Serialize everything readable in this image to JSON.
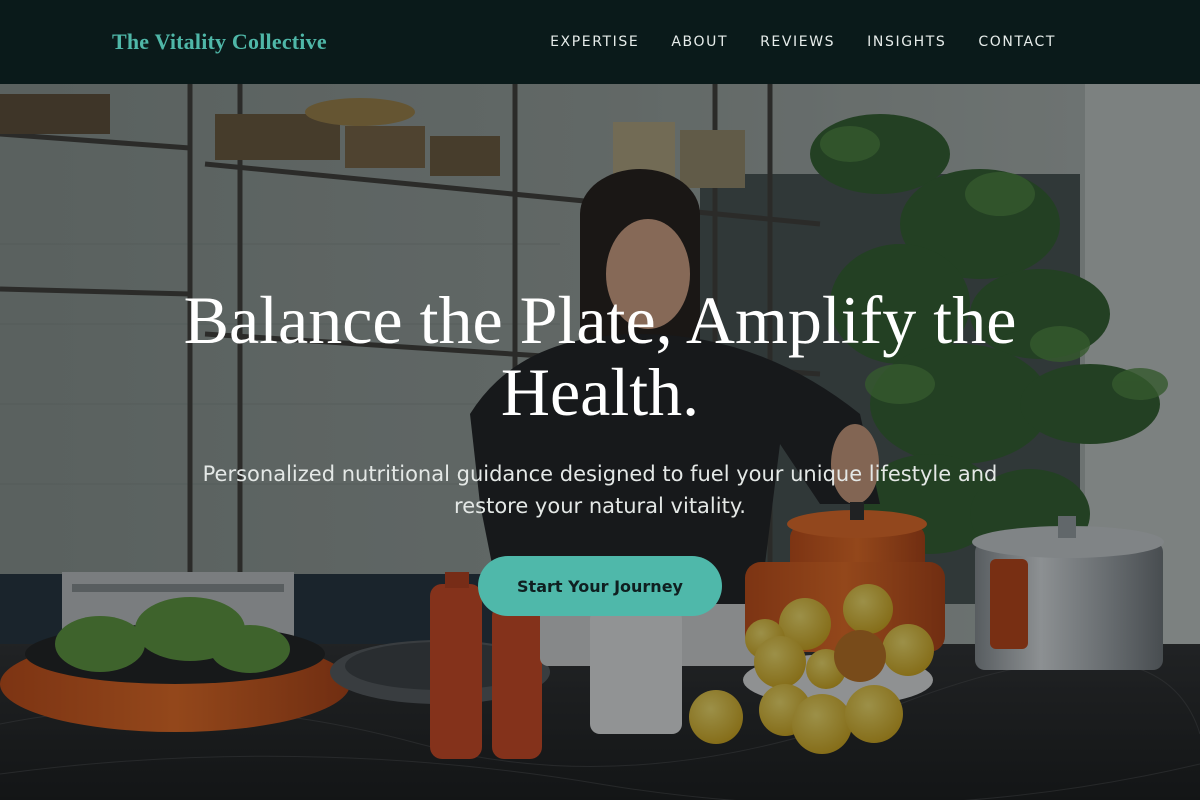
{
  "brand": {
    "name": "The Vitality Collective",
    "color": "#4fb7a8"
  },
  "nav": {
    "items": [
      {
        "label": "EXPERTISE"
      },
      {
        "label": "ABOUT"
      },
      {
        "label": "REVIEWS"
      },
      {
        "label": "INSIGHTS"
      },
      {
        "label": "CONTACT"
      }
    ]
  },
  "hero": {
    "title": "Balance the Plate, Amplify the Health.",
    "subtitle": "Personalized nutritional guidance designed to fuel your unique lifestyle and restore your natural vitality.",
    "cta_label": "Start Your Journey",
    "background_image": "kitchen-scene: woman cooking with orange pots, lemons, pepper mills, leafy plant, metal shelves",
    "accent_color": "#4fb8aa",
    "nav_bg_color": "#0a1a1a"
  }
}
